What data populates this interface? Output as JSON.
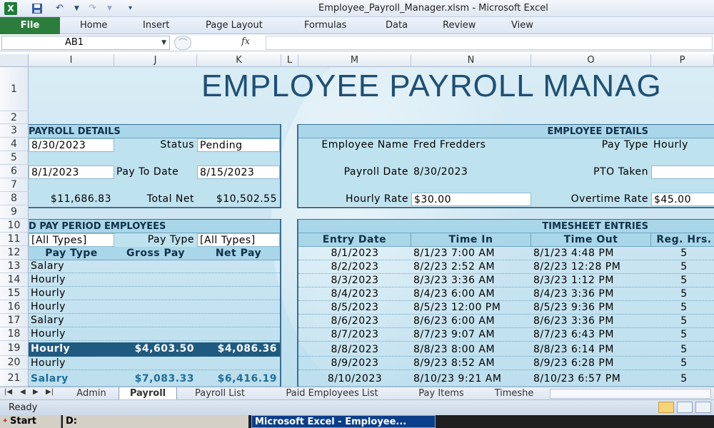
{
  "window": {
    "title": "Employee_Payroll_Manager.xlsm - Microsoft Excel",
    "app_icon": "X"
  },
  "ribbon": {
    "file": "File",
    "tabs": [
      "Home",
      "Insert",
      "Page Layout",
      "Formulas",
      "Data",
      "Review",
      "View"
    ]
  },
  "formula_bar": {
    "name_box": "AB1",
    "fx": "fx",
    "formula": ""
  },
  "columns": [
    "I",
    "J",
    "K",
    "L",
    "M",
    "N",
    "O",
    "P"
  ],
  "rows": [
    "1",
    "2",
    "3",
    "4",
    "5",
    "6",
    "7",
    "8",
    "9",
    "10",
    "11",
    "12",
    "13",
    "14",
    "15",
    "16",
    "17",
    "18",
    "19",
    "20",
    "21"
  ],
  "sheet": {
    "title": "EMPLOYEE PAYROLL MANAG",
    "payroll_details": {
      "header": "PAYROLL DETAILS",
      "r4_date": "8/30/2023",
      "status_label": "Status",
      "status_value": "Pending",
      "r6_date": "8/1/2023",
      "pay_to_date_label": "Pay To Date",
      "pay_to_date_value": "8/15/2023",
      "r8_amount": "$11,686.83",
      "total_net_label": "Total Net",
      "total_net_value": "$10,502.55"
    },
    "employee_details": {
      "header": "EMPLOYEE DETAILS",
      "name_label": "Employee Name",
      "name_value": "Fred Fredders",
      "pay_type_label": "Pay Type",
      "pay_type_value": "Hourly",
      "payroll_date_label": "Payroll Date",
      "payroll_date_value": "8/30/2023",
      "pto_label": "PTO Taken",
      "pto_value": "",
      "hourly_rate_label": "Hourly Rate",
      "hourly_rate_value": "$30.00",
      "overtime_label": "Overtime Rate",
      "overtime_value": "$45.00"
    },
    "pay_period": {
      "header": "D PAY PERIOD EMPLOYEES",
      "filter_left": "[All Types]",
      "filter_label": "Pay Type",
      "filter_right": "[All Types]",
      "columns": [
        "Pay Type",
        "Gross Pay",
        "Net Pay"
      ],
      "rows": [
        {
          "type": "Salary",
          "gross": "",
          "net": ""
        },
        {
          "type": "Hourly",
          "gross": "",
          "net": ""
        },
        {
          "type": "Hourly",
          "gross": "",
          "net": ""
        },
        {
          "type": "Hourly",
          "gross": "",
          "net": ""
        },
        {
          "type": "Salary",
          "gross": "",
          "net": ""
        },
        {
          "type": "Hourly",
          "gross": "",
          "net": ""
        },
        {
          "type": "Hourly",
          "gross": "$4,603.50",
          "net": "$4,086.36",
          "selected": true
        },
        {
          "type": "Hourly",
          "gross": "",
          "net": ""
        },
        {
          "type": "Salary",
          "gross": "$7,083.33",
          "net": "$6,416.19"
        }
      ]
    },
    "timesheet": {
      "header": "TIMESHEET ENTRIES",
      "columns": [
        "Entry Date",
        "Time In",
        "Time Out",
        "Reg. Hrs."
      ],
      "rows": [
        {
          "date": "8/1/2023",
          "in": "8/1/23 7:00 AM",
          "out": "8/1/23 4:48 PM",
          "hrs": "5"
        },
        {
          "date": "8/2/2023",
          "in": "8/2/23 2:52 AM",
          "out": "8/2/23 12:28 PM",
          "hrs": "5"
        },
        {
          "date": "8/3/2023",
          "in": "8/3/23 3:36 AM",
          "out": "8/3/23 1:12 PM",
          "hrs": "5"
        },
        {
          "date": "8/4/2023",
          "in": "8/4/23 6:00 AM",
          "out": "8/4/23 3:36 PM",
          "hrs": "5"
        },
        {
          "date": "8/5/2023",
          "in": "8/5/23 12:00 PM",
          "out": "8/5/23 9:36 PM",
          "hrs": "5"
        },
        {
          "date": "8/6/2023",
          "in": "8/6/23 6:00 AM",
          "out": "8/6/23 3:36 PM",
          "hrs": "5"
        },
        {
          "date": "8/7/2023",
          "in": "8/7/23 9:07 AM",
          "out": "8/7/23 6:43 PM",
          "hrs": "5"
        },
        {
          "date": "8/8/2023",
          "in": "8/8/23 8:00 AM",
          "out": "8/8/23 6:14 PM",
          "hrs": "5"
        },
        {
          "date": "8/9/2023",
          "in": "8/9/23 8:52 AM",
          "out": "8/9/23 6:28 PM",
          "hrs": "5"
        },
        {
          "date": "8/10/2023",
          "in": "8/10/23 9:21 AM",
          "out": "8/10/23 6:57 PM",
          "hrs": "5"
        }
      ]
    }
  },
  "sheet_tabs": [
    "Admin",
    "Payroll",
    "Payroll List",
    "Paid Employees List",
    "Pay Items",
    "Timeshe"
  ],
  "active_tab": "Payroll",
  "status": {
    "ready": "Ready"
  },
  "taskbar": {
    "start": "Start",
    "drive": "D:",
    "task": "Microsoft Excel - Employee..."
  },
  "colors": {
    "title_text": "#1f4f73",
    "header_fill": "#a9d6e8",
    "selected_row": "#1f5a80",
    "file_tab": "#2c7d3c"
  }
}
